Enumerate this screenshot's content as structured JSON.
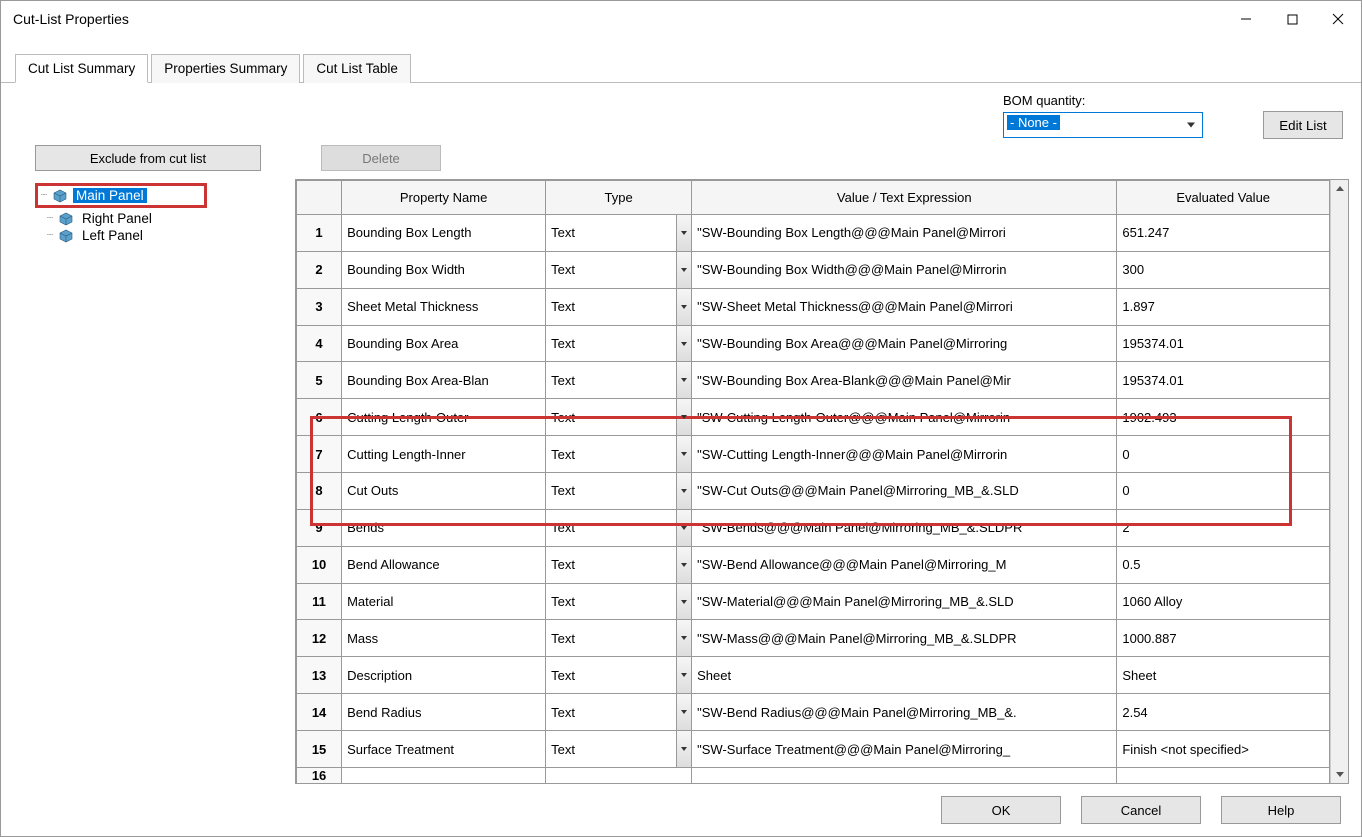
{
  "window": {
    "title": "Cut-List Properties"
  },
  "tabs": [
    {
      "label": "Cut List Summary",
      "active": true
    },
    {
      "label": "Properties Summary",
      "active": false
    },
    {
      "label": "Cut List Table",
      "active": false
    }
  ],
  "bom": {
    "label": "BOM quantity:",
    "value": "- None -"
  },
  "buttons": {
    "editList": "Edit List",
    "exclude": "Exclude from cut list",
    "delete": "Delete",
    "ok": "OK",
    "cancel": "Cancel",
    "help": "Help"
  },
  "tree": [
    {
      "label": "Main Panel",
      "selected": true
    },
    {
      "label": "Right Panel",
      "selected": false
    },
    {
      "label": "Left Panel",
      "selected": false
    }
  ],
  "grid": {
    "headers": {
      "name": "Property Name",
      "type": "Type",
      "val": "Value / Text Expression",
      "eval": "Evaluated Value"
    },
    "rows": [
      {
        "n": "1",
        "name": "Bounding Box Length",
        "type": "Text",
        "val": "\"SW-Bounding Box Length@@@Main Panel@Mirrori",
        "eval": "651.247"
      },
      {
        "n": "2",
        "name": "Bounding Box Width",
        "type": "Text",
        "val": "\"SW-Bounding Box Width@@@Main Panel@Mirrorin",
        "eval": "300"
      },
      {
        "n": "3",
        "name": "Sheet Metal Thickness",
        "type": "Text",
        "val": "\"SW-Sheet Metal Thickness@@@Main Panel@Mirrori",
        "eval": "1.897"
      },
      {
        "n": "4",
        "name": "Bounding Box Area",
        "type": "Text",
        "val": "\"SW-Bounding Box Area@@@Main Panel@Mirroring",
        "eval": "195374.01"
      },
      {
        "n": "5",
        "name": "Bounding Box Area-Blan",
        "type": "Text",
        "val": "\"SW-Bounding Box Area-Blank@@@Main Panel@Mir",
        "eval": "195374.01"
      },
      {
        "n": "6",
        "name": "Cutting Length-Outer",
        "type": "Text",
        "val": "\"SW-Cutting Length-Outer@@@Main Panel@Mirrorin",
        "eval": "1902.493"
      },
      {
        "n": "7",
        "name": "Cutting Length-Inner",
        "type": "Text",
        "val": "\"SW-Cutting Length-Inner@@@Main Panel@Mirrorin",
        "eval": "0"
      },
      {
        "n": "8",
        "name": "Cut Outs",
        "type": "Text",
        "val": "\"SW-Cut Outs@@@Main Panel@Mirroring_MB_&.SLD",
        "eval": "0"
      },
      {
        "n": "9",
        "name": "Bends",
        "type": "Text",
        "val": "\"SW-Bends@@@Main Panel@Mirroring_MB_&.SLDPR",
        "eval": "2"
      },
      {
        "n": "10",
        "name": "Bend Allowance",
        "type": "Text",
        "val": "\"SW-Bend Allowance@@@Main Panel@Mirroring_M",
        "eval": "0.5"
      },
      {
        "n": "11",
        "name": "Material",
        "type": "Text",
        "val": "\"SW-Material@@@Main Panel@Mirroring_MB_&.SLD",
        "eval": "1060 Alloy"
      },
      {
        "n": "12",
        "name": "Mass",
        "type": "Text",
        "val": "\"SW-Mass@@@Main Panel@Mirroring_MB_&.SLDPR",
        "eval": "1000.887"
      },
      {
        "n": "13",
        "name": "Description",
        "type": "Text",
        "val": "Sheet",
        "eval": "Sheet"
      },
      {
        "n": "14",
        "name": "Bend Radius",
        "type": "Text",
        "val": "\"SW-Bend Radius@@@Main Panel@Mirroring_MB_&.",
        "eval": "2.54"
      },
      {
        "n": "15",
        "name": "Surface Treatment",
        "type": "Text",
        "val": "\"SW-Surface Treatment@@@Main Panel@Mirroring_",
        "eval": "Finish <not specified>"
      },
      {
        "n": "16",
        "name": "",
        "type": "",
        "val": "",
        "eval": ""
      }
    ]
  }
}
